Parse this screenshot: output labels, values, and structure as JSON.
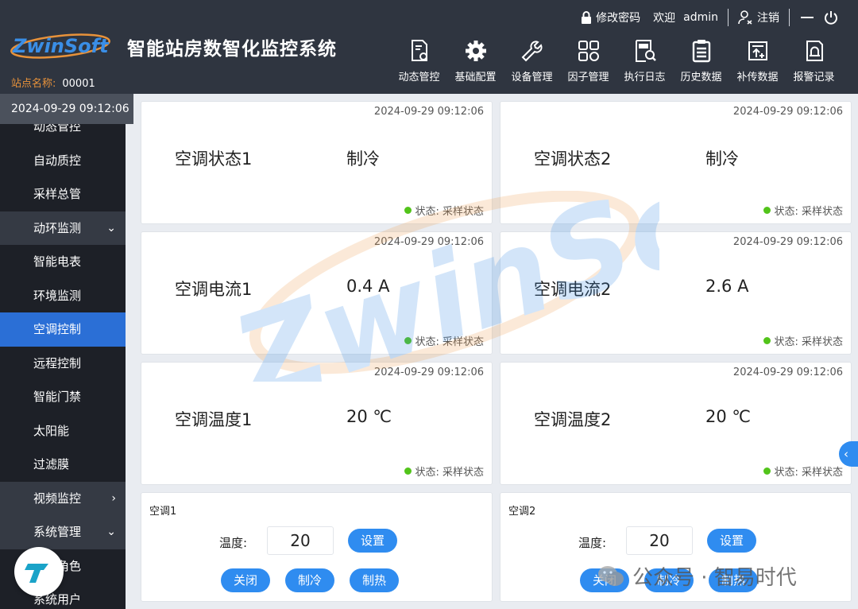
{
  "header": {
    "logo_text": "ZwinSoft",
    "system_title": "智能站房数智化监控系统",
    "station_label": "站点名称:",
    "station_value": "00001",
    "change_password": "修改密码",
    "welcome": "欢迎",
    "username": "admin",
    "logout": "注销",
    "nav": [
      {
        "label": "动态管控",
        "icon": "document-gear-icon"
      },
      {
        "label": "基础配置",
        "icon": "gear-icon"
      },
      {
        "label": "设备管理",
        "icon": "wrench-icon"
      },
      {
        "label": "因子管理",
        "icon": "grid-gear-icon"
      },
      {
        "label": "执行日志",
        "icon": "log-search-icon"
      },
      {
        "label": "历史数据",
        "icon": "clipboard-icon"
      },
      {
        "label": "补传数据",
        "icon": "upload-box-icon"
      },
      {
        "label": "报警记录",
        "icon": "alarm-bell-icon"
      }
    ]
  },
  "sidebar": {
    "datetime": "2024-09-29 09:12:06",
    "items": [
      {
        "label": "动态管控",
        "type": "item"
      },
      {
        "label": "自动质控",
        "type": "item"
      },
      {
        "label": "采样总管",
        "type": "item"
      },
      {
        "label": "动环监测",
        "type": "group",
        "chevron": "down"
      },
      {
        "label": "智能电表",
        "type": "item"
      },
      {
        "label": "环境监测",
        "type": "item"
      },
      {
        "label": "空调控制",
        "type": "active"
      },
      {
        "label": "远程控制",
        "type": "item"
      },
      {
        "label": "智能门禁",
        "type": "item"
      },
      {
        "label": "太阳能",
        "type": "item"
      },
      {
        "label": "过滤膜",
        "type": "item"
      },
      {
        "label": "视频监控",
        "type": "group",
        "chevron": "right"
      },
      {
        "label": "系统管理",
        "type": "group",
        "chevron": "down"
      },
      {
        "label": "系统角色",
        "type": "item"
      },
      {
        "label": "系统用户",
        "type": "item"
      }
    ]
  },
  "cards": [
    {
      "timestamp": "2024-09-29 09:12:06",
      "name": "空调状态1",
      "value": "制冷",
      "status": "状态: 采样状态"
    },
    {
      "timestamp": "2024-09-29 09:12:06",
      "name": "空调状态2",
      "value": "制冷",
      "status": "状态: 采样状态"
    },
    {
      "timestamp": "2024-09-29 09:12:06",
      "name": "空调电流1",
      "value": "0.4 A",
      "status": "状态: 采样状态"
    },
    {
      "timestamp": "2024-09-29 09:12:06",
      "name": "空调电流2",
      "value": "2.6 A",
      "status": "状态: 采样状态"
    },
    {
      "timestamp": "2024-09-29 09:12:06",
      "name": "空调温度1",
      "value": "20 ℃",
      "status": "状态: 采样状态"
    },
    {
      "timestamp": "2024-09-29 09:12:06",
      "name": "空调温度2",
      "value": "20 ℃",
      "status": "状态: 采样状态"
    }
  ],
  "controls": [
    {
      "name": "空调1",
      "temp_label": "温度:",
      "temp_value": "20",
      "set": "设置",
      "off": "关闭",
      "cool": "制冷",
      "heat": "制热"
    },
    {
      "name": "空调2",
      "temp_label": "温度:",
      "temp_value": "20",
      "set": "设置",
      "off": "关闭",
      "cool": "制冷",
      "heat": "制热"
    }
  ],
  "overlay": {
    "wechat_text": "公众号 · 智易时代"
  },
  "colors": {
    "header_bg": "#2f3540",
    "sidebar_bg": "#1d2027",
    "active": "#2b6fd6",
    "button": "#2f8cf0",
    "status_dot": "#52c41a",
    "station_label": "#e8923a"
  }
}
